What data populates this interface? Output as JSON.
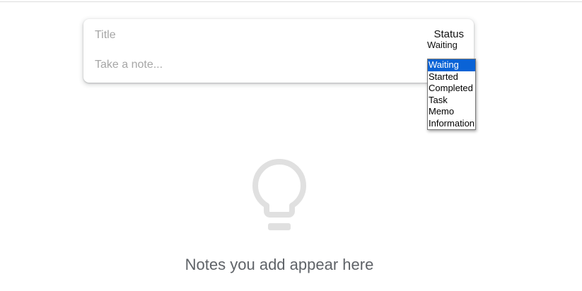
{
  "composer": {
    "title_placeholder": "Title",
    "note_placeholder": "Take a note...",
    "status_label": "Status",
    "status_value": "Waiting"
  },
  "status_options": [
    {
      "label": "Waiting",
      "selected": true
    },
    {
      "label": "Started",
      "selected": false
    },
    {
      "label": "Completed",
      "selected": false
    },
    {
      "label": "Task",
      "selected": false
    },
    {
      "label": "Memo",
      "selected": false
    },
    {
      "label": "Information",
      "selected": false
    }
  ],
  "empty_state": {
    "icon": "lightbulb-icon",
    "message": "Notes you add appear here"
  },
  "colors": {
    "selection": "#0a63d6",
    "icon_gray": "#e0e0e0",
    "message_gray": "#5f6368"
  }
}
